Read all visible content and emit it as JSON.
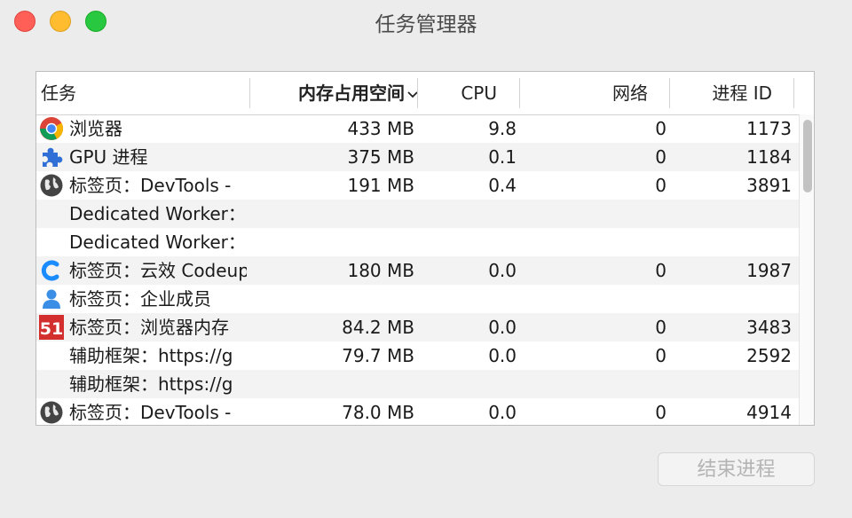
{
  "window": {
    "title": "任务管理器"
  },
  "columns": {
    "task": "任务",
    "memory": "内存占用空间",
    "cpu": "CPU",
    "network": "网络",
    "pid": "进程 ID"
  },
  "rows": [
    {
      "icon": "chrome-icon",
      "task": "浏览器",
      "memory": "433 MB",
      "cpu": "9.8",
      "network": "0",
      "pid": "1173"
    },
    {
      "icon": "puzzle-icon",
      "task": "GPU 进程",
      "memory": "375 MB",
      "cpu": "0.1",
      "network": "0",
      "pid": "1184"
    },
    {
      "icon": "globe-icon",
      "task": "标签页：DevTools - ",
      "memory": "191 MB",
      "cpu": "0.4",
      "network": "0",
      "pid": "3891"
    },
    {
      "icon": "",
      "task": "Dedicated Worker：",
      "memory": "",
      "cpu": "",
      "network": "",
      "pid": ""
    },
    {
      "icon": "",
      "task": "Dedicated Worker：",
      "memory": "",
      "cpu": "",
      "network": "",
      "pid": ""
    },
    {
      "icon": "codeup-icon",
      "task": "标签页：云效 Codeup",
      "memory": "180 MB",
      "cpu": "0.0",
      "network": "0",
      "pid": "1987"
    },
    {
      "icon": "person-icon",
      "task": "标签页：企业成员",
      "memory": "",
      "cpu": "",
      "network": "",
      "pid": ""
    },
    {
      "icon": "site51-icon",
      "task": "标签页：浏览器内存",
      "memory": "84.2 MB",
      "cpu": "0.0",
      "network": "0",
      "pid": "3483"
    },
    {
      "icon": "",
      "task": "辅助框架：https://g",
      "memory": "79.7 MB",
      "cpu": "0.0",
      "network": "0",
      "pid": "2592"
    },
    {
      "icon": "",
      "task": "辅助框架：https://g",
      "memory": "",
      "cpu": "",
      "network": "",
      "pid": ""
    },
    {
      "icon": "globe-icon",
      "task": "标签页：DevTools - ",
      "memory": "78.0 MB",
      "cpu": "0.0",
      "network": "0",
      "pid": "4914"
    }
  ],
  "actions": {
    "end_process": "结束进程"
  },
  "colors": {
    "close": "#ff5f57",
    "minimize": "#febc2e",
    "zoom": "#28c840"
  }
}
